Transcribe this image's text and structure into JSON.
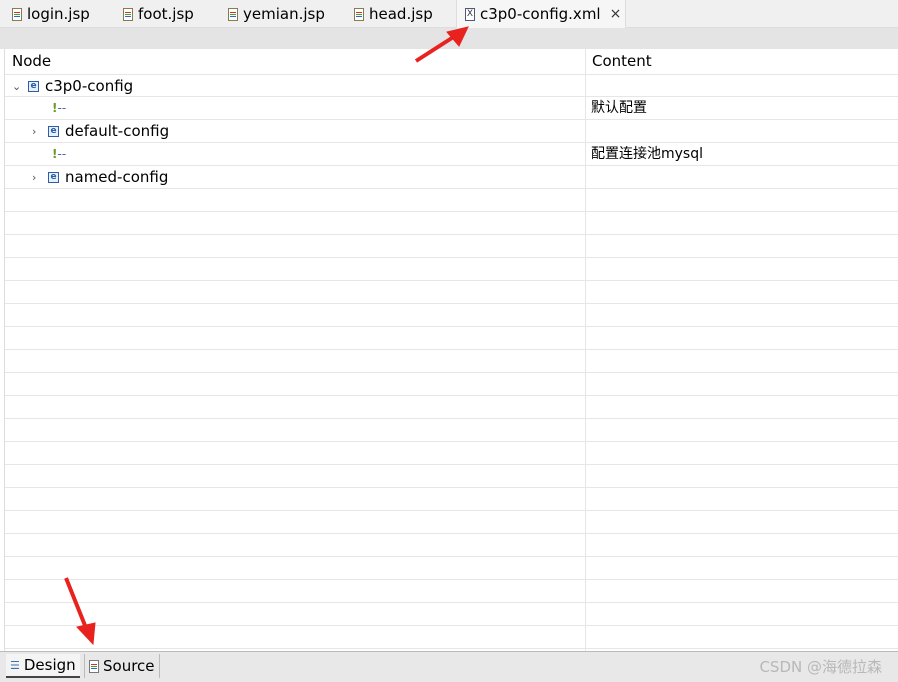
{
  "tabs": [
    {
      "label": "login.jsp",
      "icon": "jsp-file-icon"
    },
    {
      "label": "foot.jsp",
      "icon": "jsp-file-icon"
    },
    {
      "label": "yemian.jsp",
      "icon": "jsp-file-icon"
    },
    {
      "label": "head.jsp",
      "icon": "jsp-file-icon"
    },
    {
      "label": "c3p0-config.xml",
      "icon": "xml-file-icon",
      "active": true,
      "close": "×"
    }
  ],
  "table": {
    "headers": {
      "node": "Node",
      "content": "Content"
    },
    "rows": [
      {
        "node": "c3p0-config",
        "type": "element",
        "expanded": true,
        "content": ""
      },
      {
        "node": "--",
        "type": "comment",
        "content": "默认配置"
      },
      {
        "node": "default-config",
        "type": "element",
        "expanded": false,
        "content": ""
      },
      {
        "node": "--",
        "type": "comment",
        "content": "配置连接池mysql"
      },
      {
        "node": "named-config",
        "type": "element",
        "expanded": false,
        "content": ""
      }
    ]
  },
  "bottom_tabs": {
    "design": "Design",
    "source": "Source"
  },
  "watermark": "CSDN @海德拉森",
  "annotation_color": "#e8231f"
}
